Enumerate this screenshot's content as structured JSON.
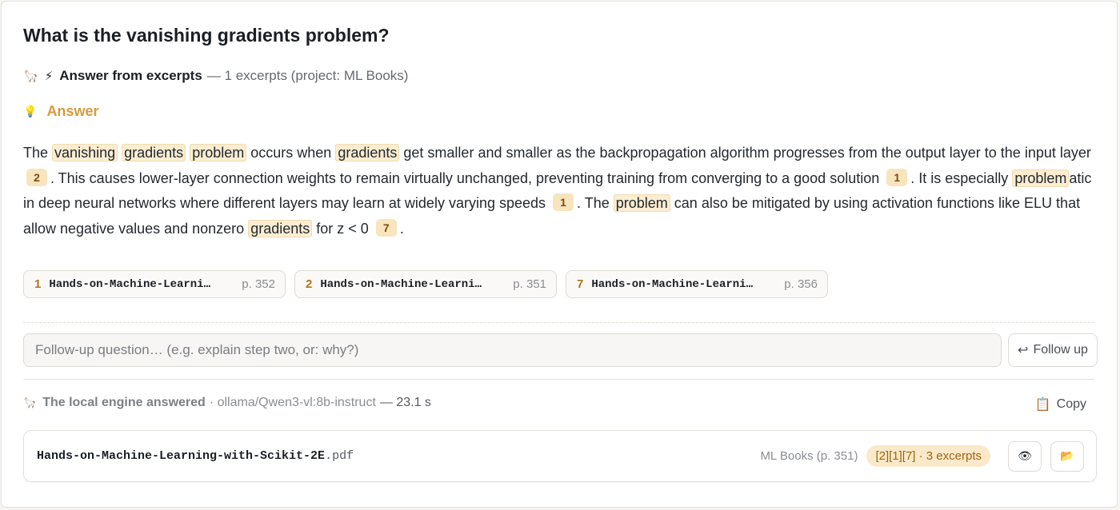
{
  "question": "What is the vanishing gradients problem?",
  "source_line": {
    "icon_engine": "llama-icon",
    "icon_bolt": "lightning-icon",
    "label": "Answer from excerpts",
    "detail": "— 1 excerpts (project: ML Books)"
  },
  "answer_label": "Answer",
  "answer": {
    "s1": "The",
    "h1": "vanishing",
    "h2": "gradients",
    "h3": "problem",
    "s2": "occurs when",
    "h4": "gradients",
    "s3": "get smaller and smaller as the backpropagation algorithm progresses from the output layer to the input layer",
    "c1": "2",
    "s4": ". This causes lower-layer connection weights to remain virtually unchanged, preventing training from converging to a good solution",
    "c2": "1",
    "s5": ". It is especially",
    "h5": "problem",
    "s6": "atic in deep neural networks where different layers may learn at widely varying speeds",
    "c3": "1",
    "s7": ". The",
    "h6": "problem",
    "s8": "can also be mitigated by using activation functions like ELU that allow negative values and nonzero",
    "h7": "gradients",
    "s9": "for z < 0",
    "c4": "7",
    "s10": "."
  },
  "sources": [
    {
      "num": "1",
      "doc": "Hands-on-Machine-Learni…",
      "page": "p. 352"
    },
    {
      "num": "2",
      "doc": "Hands-on-Machine-Learni…",
      "page": "p. 351"
    },
    {
      "num": "7",
      "doc": "Hands-on-Machine-Learni…",
      "page": "p. 356"
    }
  ],
  "followup": {
    "placeholder": "Follow-up question… (e.g. explain step two, or: why?)",
    "button_label": "Follow up"
  },
  "engine": {
    "label": "The local engine answered",
    "model": "· ollama/Qwen3-vl:8b-instruct",
    "time": "— 23.1 s"
  },
  "copy_label": "Copy",
  "file": {
    "name": "Hands-on-Machine-Learning-with-Scikit-2E",
    "ext": ".pdf",
    "meta": "ML Books (p. 351)",
    "badge": "[2][1][7] · 3 excerpts"
  },
  "colors": {
    "accent": "#d79a3c",
    "highlight_bg": "#fbedd2",
    "citation_bg": "#f8e5bd",
    "citation_text": "#7a4e12"
  }
}
